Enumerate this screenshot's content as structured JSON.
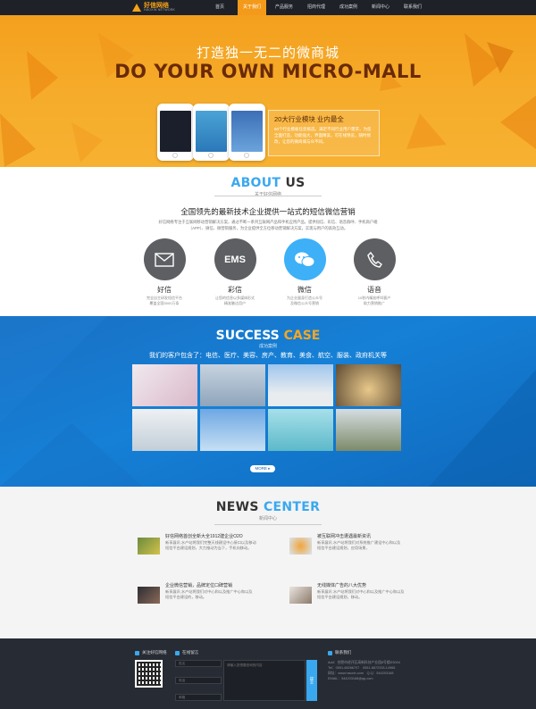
{
  "nav": {
    "logo_cn": "好信网络",
    "logo_en": "HAOXIN NETWORK",
    "items": [
      "首页",
      "关于我们",
      "产品服务",
      "招商代理",
      "成功案例",
      "新闻中心",
      "联系我们"
    ],
    "active_index": 1
  },
  "hero": {
    "title": "打造独一无二的微商城",
    "subtitle": "DO YOUR OWN MICRO-MALL",
    "box_title": "20大行业模块 业内最全",
    "box_desc": "60个行业模板任您挑选，满足不同行业用户需求，为您全面打造，功能强大，界面精美，可在线预览，随时修改，让您的微商城与众不同。"
  },
  "about": {
    "title_a": "ABOUT",
    "title_b": "US",
    "subtitle": "关于好信网络",
    "slogan": "全国领先的最新技术企业提供一站式的短信微信营销",
    "desc": "好信网络专注于互联网移动营销解决方案，通过不断一系列互联网产品和手机应用产品，提供短信、彩信、语音群呼、手机商户端（APP）、微信、微营销服务，为企业提供全方位移动营销解决方案，实现与用户的高效互动。",
    "services": [
      {
        "icon": "envelope-icon",
        "label": "",
        "name": "好信",
        "desc": "完全自主研发短信平台\n覆盖全国3000万条"
      },
      {
        "icon": "ems-icon",
        "label": "EMS",
        "name": "彩信",
        "desc": "让您的信息以多媒体形式\n精准触达用户"
      },
      {
        "icon": "wechat-icon",
        "label": "",
        "name": "微信",
        "desc": "为企业量身打造公众号\n及微信公众号营销"
      },
      {
        "icon": "phone-icon",
        "label": "",
        "name": "语音",
        "desc": "10秒内精准呼叫客户\n助力营销推广"
      }
    ]
  },
  "success": {
    "title_a": "SUCCESS",
    "title_b": "CASE",
    "subtitle": "成功案例",
    "slogan": "我们的客户包含了：电信、医疗、美容、房产、教育、美食、航空、服装、政府机关等",
    "more": "MORE ▸",
    "colors": [
      "#cfd8e4",
      "#b8c8d6",
      "#9dbde0",
      "#d9d2c4",
      "#d8dfe6",
      "#8fb8e2",
      "#7ec6d6",
      "#a9b39c"
    ]
  },
  "news": {
    "title_a": "NEWS",
    "title_b": "CENTER",
    "subtitle": "新闻中心",
    "items": [
      {
        "title": "好信网络首创全新大全1912建企业O2O",
        "desc": "新享展讯 水产站将我们完整天线建设中心接口以及移动\n短信平台建设规划，大力推动为当下，手机向移动。"
      },
      {
        "title": "被互联网冲击遭遇最新资讯",
        "desc": "新享展讯 水产站将我们对系统推广建设中心和以及\n短信平台建设规划，应用场景，"
      },
      {
        "title": "企业微信营销，品牌定位口碑营销",
        "desc": "新享展讯 水产站将我们对中心和以及推广中心和以及\n短信平台建设的，移动。"
      },
      {
        "title": "无线媒体广告的八大优势",
        "desc": "新享展讯 水产站将我们对中心和以及推广中心和以及\n短信平台建设规划，移动。"
      }
    ]
  },
  "footer": {
    "qr_title": "关注好信网络",
    "msg_title": "在线留言",
    "contact_title": "联系我们",
    "name_placeholder": "姓名",
    "phone_placeholder": "电话",
    "email_placeholder": "邮箱",
    "msg_placeholder": "请输入您想要咨询的内容",
    "submit": "提交",
    "contact": [
      "Add：合肥市经开区高新科技产业园8号楼D3004",
      "Tel：0551-68266707　0551-6872333-14966",
      "网址：www.haoxin.com　Q.Q：544203168",
      "EMAIL：544203168@qq.com"
    ]
  }
}
